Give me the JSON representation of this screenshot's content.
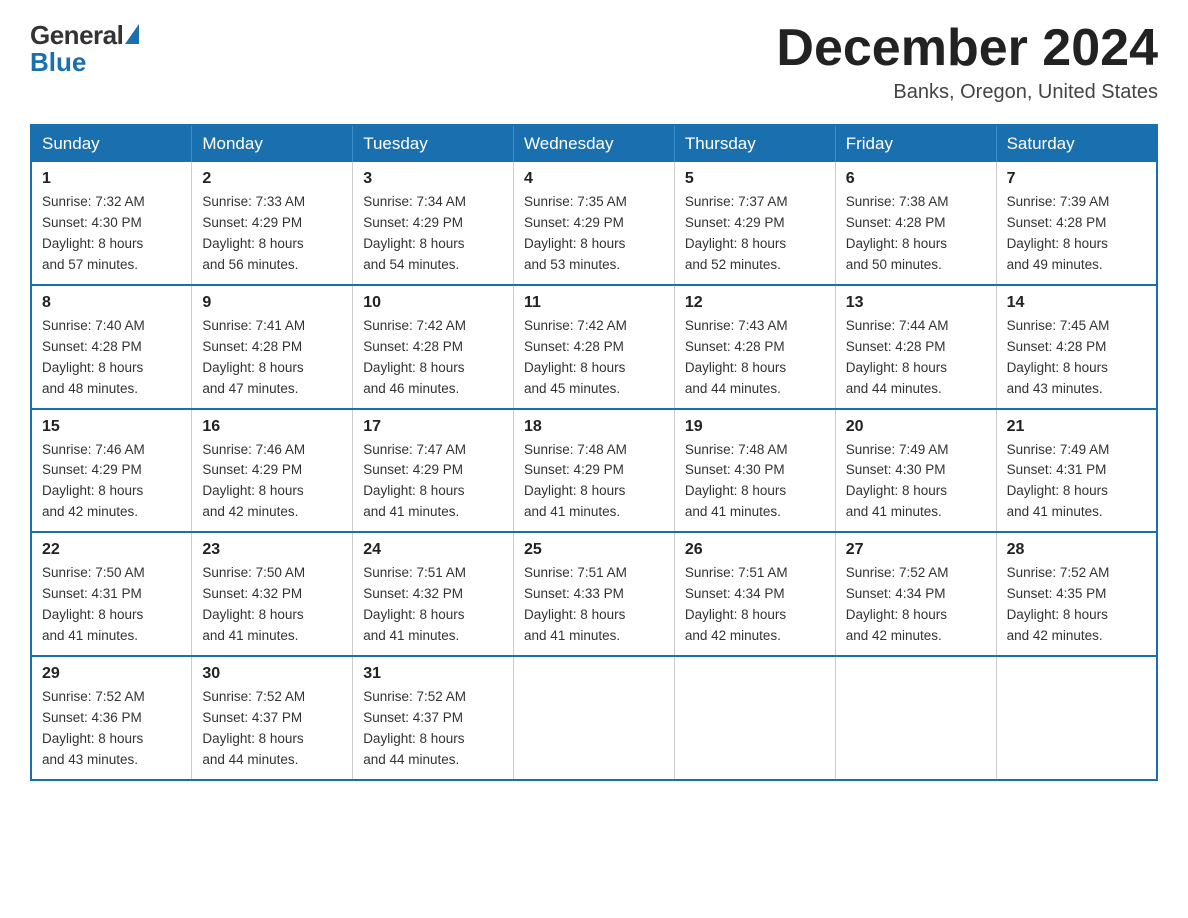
{
  "header": {
    "logo_general": "General",
    "logo_blue": "Blue",
    "month_title": "December 2024",
    "location": "Banks, Oregon, United States"
  },
  "days_of_week": [
    "Sunday",
    "Monday",
    "Tuesday",
    "Wednesday",
    "Thursday",
    "Friday",
    "Saturday"
  ],
  "weeks": [
    [
      {
        "day": "1",
        "sunrise": "7:32 AM",
        "sunset": "4:30 PM",
        "daylight": "8 hours and 57 minutes."
      },
      {
        "day": "2",
        "sunrise": "7:33 AM",
        "sunset": "4:29 PM",
        "daylight": "8 hours and 56 minutes."
      },
      {
        "day": "3",
        "sunrise": "7:34 AM",
        "sunset": "4:29 PM",
        "daylight": "8 hours and 54 minutes."
      },
      {
        "day": "4",
        "sunrise": "7:35 AM",
        "sunset": "4:29 PM",
        "daylight": "8 hours and 53 minutes."
      },
      {
        "day": "5",
        "sunrise": "7:37 AM",
        "sunset": "4:29 PM",
        "daylight": "8 hours and 52 minutes."
      },
      {
        "day": "6",
        "sunrise": "7:38 AM",
        "sunset": "4:28 PM",
        "daylight": "8 hours and 50 minutes."
      },
      {
        "day": "7",
        "sunrise": "7:39 AM",
        "sunset": "4:28 PM",
        "daylight": "8 hours and 49 minutes."
      }
    ],
    [
      {
        "day": "8",
        "sunrise": "7:40 AM",
        "sunset": "4:28 PM",
        "daylight": "8 hours and 48 minutes."
      },
      {
        "day": "9",
        "sunrise": "7:41 AM",
        "sunset": "4:28 PM",
        "daylight": "8 hours and 47 minutes."
      },
      {
        "day": "10",
        "sunrise": "7:42 AM",
        "sunset": "4:28 PM",
        "daylight": "8 hours and 46 minutes."
      },
      {
        "day": "11",
        "sunrise": "7:42 AM",
        "sunset": "4:28 PM",
        "daylight": "8 hours and 45 minutes."
      },
      {
        "day": "12",
        "sunrise": "7:43 AM",
        "sunset": "4:28 PM",
        "daylight": "8 hours and 44 minutes."
      },
      {
        "day": "13",
        "sunrise": "7:44 AM",
        "sunset": "4:28 PM",
        "daylight": "8 hours and 44 minutes."
      },
      {
        "day": "14",
        "sunrise": "7:45 AM",
        "sunset": "4:28 PM",
        "daylight": "8 hours and 43 minutes."
      }
    ],
    [
      {
        "day": "15",
        "sunrise": "7:46 AM",
        "sunset": "4:29 PM",
        "daylight": "8 hours and 42 minutes."
      },
      {
        "day": "16",
        "sunrise": "7:46 AM",
        "sunset": "4:29 PM",
        "daylight": "8 hours and 42 minutes."
      },
      {
        "day": "17",
        "sunrise": "7:47 AM",
        "sunset": "4:29 PM",
        "daylight": "8 hours and 41 minutes."
      },
      {
        "day": "18",
        "sunrise": "7:48 AM",
        "sunset": "4:29 PM",
        "daylight": "8 hours and 41 minutes."
      },
      {
        "day": "19",
        "sunrise": "7:48 AM",
        "sunset": "4:30 PM",
        "daylight": "8 hours and 41 minutes."
      },
      {
        "day": "20",
        "sunrise": "7:49 AM",
        "sunset": "4:30 PM",
        "daylight": "8 hours and 41 minutes."
      },
      {
        "day": "21",
        "sunrise": "7:49 AM",
        "sunset": "4:31 PM",
        "daylight": "8 hours and 41 minutes."
      }
    ],
    [
      {
        "day": "22",
        "sunrise": "7:50 AM",
        "sunset": "4:31 PM",
        "daylight": "8 hours and 41 minutes."
      },
      {
        "day": "23",
        "sunrise": "7:50 AM",
        "sunset": "4:32 PM",
        "daylight": "8 hours and 41 minutes."
      },
      {
        "day": "24",
        "sunrise": "7:51 AM",
        "sunset": "4:32 PM",
        "daylight": "8 hours and 41 minutes."
      },
      {
        "day": "25",
        "sunrise": "7:51 AM",
        "sunset": "4:33 PM",
        "daylight": "8 hours and 41 minutes."
      },
      {
        "day": "26",
        "sunrise": "7:51 AM",
        "sunset": "4:34 PM",
        "daylight": "8 hours and 42 minutes."
      },
      {
        "day": "27",
        "sunrise": "7:52 AM",
        "sunset": "4:34 PM",
        "daylight": "8 hours and 42 minutes."
      },
      {
        "day": "28",
        "sunrise": "7:52 AM",
        "sunset": "4:35 PM",
        "daylight": "8 hours and 42 minutes."
      }
    ],
    [
      {
        "day": "29",
        "sunrise": "7:52 AM",
        "sunset": "4:36 PM",
        "daylight": "8 hours and 43 minutes."
      },
      {
        "day": "30",
        "sunrise": "7:52 AM",
        "sunset": "4:37 PM",
        "daylight": "8 hours and 44 minutes."
      },
      {
        "day": "31",
        "sunrise": "7:52 AM",
        "sunset": "4:37 PM",
        "daylight": "8 hours and 44 minutes."
      },
      null,
      null,
      null,
      null
    ]
  ],
  "labels": {
    "sunrise": "Sunrise:",
    "sunset": "Sunset:",
    "daylight": "Daylight:"
  }
}
